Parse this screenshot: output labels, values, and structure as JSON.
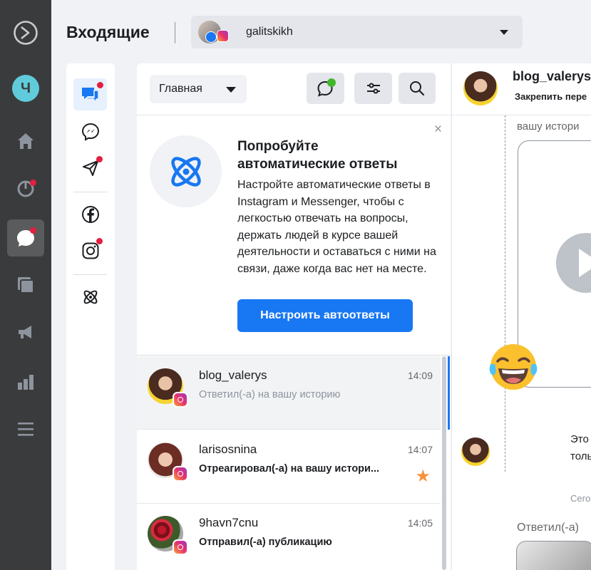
{
  "header": {
    "title": "Входящие",
    "account_name": "galitskikh"
  },
  "sidebar": {
    "avatar_letter": "Ч"
  },
  "list": {
    "filter_label": "Главная",
    "promo": {
      "title": "Попробуйте автоматические ответы",
      "text": "Настройте автоматические ответы в Instagram и Messenger, чтобы с легкостью отвечать на вопросы, держать людей в курсе вашей деятельности и оставаться с ними на связи, даже когда вас нет на месте.",
      "button_label": "Настроить автоответы",
      "close": "×"
    },
    "conversations": [
      {
        "name": "blog_valerys",
        "time": "14:09",
        "preview": "Ответил(-а) на вашу историю",
        "unread": false,
        "starred": false
      },
      {
        "name": "larisosnina",
        "time": "14:07",
        "preview": "Отреагировал(-а) на вашу истори...",
        "unread": true,
        "starred": true
      },
      {
        "name": "9havn7cnu",
        "time": "14:05",
        "preview": "Отправил(-а) публикацию",
        "unread": true,
        "starred": false
      }
    ]
  },
  "chat": {
    "name": "blog_valerys",
    "pin_label": "Закрепить пере",
    "story_caption": "вашу истори",
    "message_line1": "Это",
    "message_line2": "толь",
    "date_sep": "Сего",
    "reply_caption": "Ответил(-а)",
    "emoji": "😂"
  },
  "colors": {
    "accent": "#1877f2",
    "dark_sidebar": "#3a3b3c",
    "notification": "#e41e3f",
    "star": "#f7923a"
  }
}
